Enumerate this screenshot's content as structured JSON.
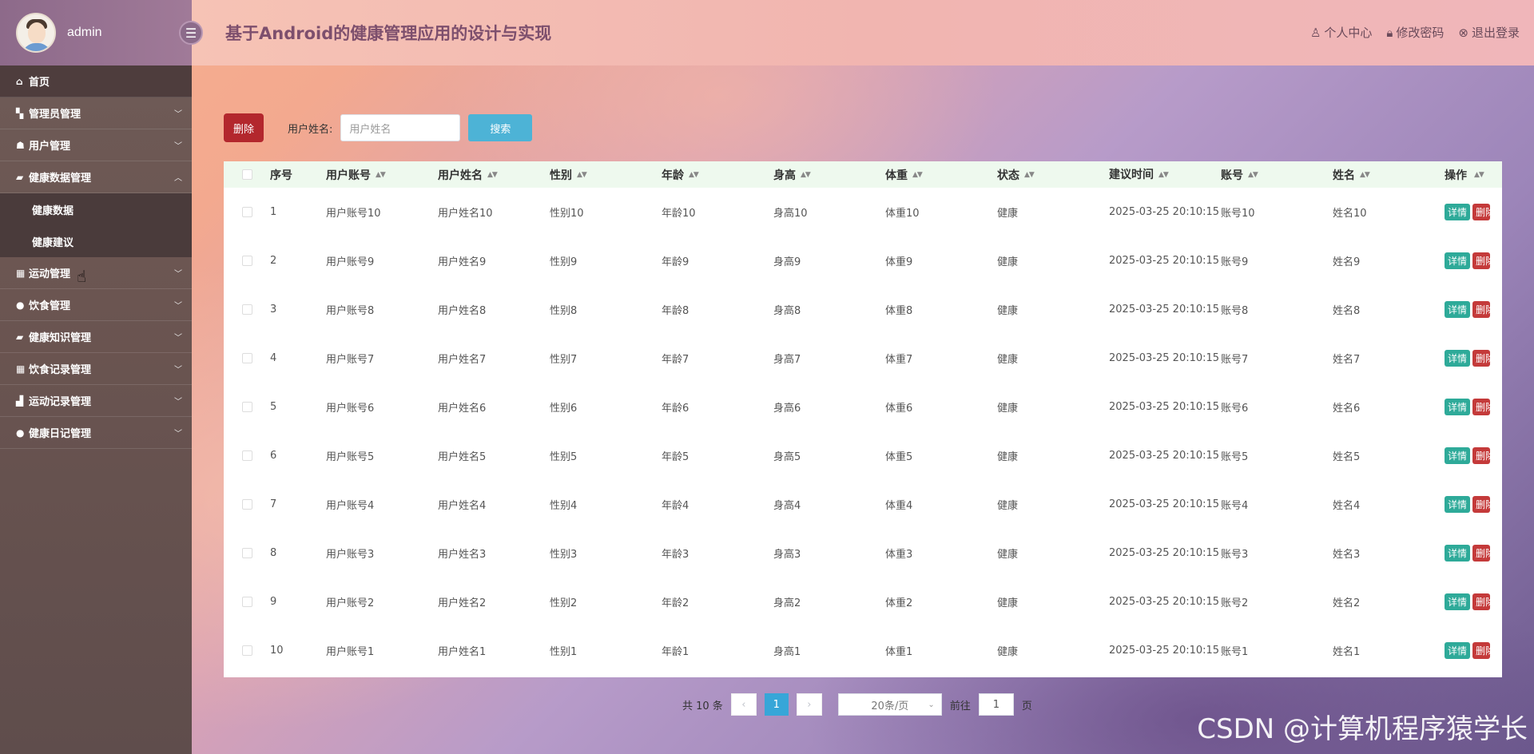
{
  "sidebar": {
    "username": "admin",
    "menu": [
      {
        "icon": "⌂",
        "label": "首页"
      },
      {
        "icon": "▚",
        "label": "管理员管理"
      },
      {
        "icon": "☗",
        "label": "用户管理"
      },
      {
        "icon": "▰",
        "label": "健康数据管理"
      },
      {
        "icon": "▦",
        "label": "运动管理"
      },
      {
        "icon": "●",
        "label": "饮食管理"
      },
      {
        "icon": "▰",
        "label": "健康知识管理"
      },
      {
        "icon": "▦",
        "label": "饮食记录管理"
      },
      {
        "icon": "▟",
        "label": "运动记录管理"
      },
      {
        "icon": "●",
        "label": "健康日记管理"
      }
    ],
    "submenu": [
      "健康数据",
      "健康建议"
    ]
  },
  "header": {
    "title": "基于Android的健康管理应用的设计与实现",
    "links": [
      "个人中心",
      "修改密码",
      "退出登录"
    ]
  },
  "toolbar": {
    "delete_label": "删除",
    "search_label": "用户姓名:",
    "search_placeholder": "用户姓名",
    "search_button": "搜索"
  },
  "table": {
    "columns": [
      "序号",
      "用户账号",
      "用户姓名",
      "性别",
      "年龄",
      "身高",
      "体重",
      "状态",
      "建议时间",
      "账号",
      "姓名",
      "操作"
    ],
    "rows": [
      [
        "1",
        "用户账号10",
        "用户姓名10",
        "性别10",
        "年龄10",
        "身高10",
        "体重10",
        "健康",
        "2025-03-25 20:10:15",
        "账号10",
        "姓名10"
      ],
      [
        "2",
        "用户账号9",
        "用户姓名9",
        "性别9",
        "年龄9",
        "身高9",
        "体重9",
        "健康",
        "2025-03-25 20:10:15",
        "账号9",
        "姓名9"
      ],
      [
        "3",
        "用户账号8",
        "用户姓名8",
        "性别8",
        "年龄8",
        "身高8",
        "体重8",
        "健康",
        "2025-03-25 20:10:15",
        "账号8",
        "姓名8"
      ],
      [
        "4",
        "用户账号7",
        "用户姓名7",
        "性别7",
        "年龄7",
        "身高7",
        "体重7",
        "健康",
        "2025-03-25 20:10:15",
        "账号7",
        "姓名7"
      ],
      [
        "5",
        "用户账号6",
        "用户姓名6",
        "性别6",
        "年龄6",
        "身高6",
        "体重6",
        "健康",
        "2025-03-25 20:10:15",
        "账号6",
        "姓名6"
      ],
      [
        "6",
        "用户账号5",
        "用户姓名5",
        "性别5",
        "年龄5",
        "身高5",
        "体重5",
        "健康",
        "2025-03-25 20:10:15",
        "账号5",
        "姓名5"
      ],
      [
        "7",
        "用户账号4",
        "用户姓名4",
        "性别4",
        "年龄4",
        "身高4",
        "体重4",
        "健康",
        "2025-03-25 20:10:15",
        "账号4",
        "姓名4"
      ],
      [
        "8",
        "用户账号3",
        "用户姓名3",
        "性别3",
        "年龄3",
        "身高3",
        "体重3",
        "健康",
        "2025-03-25 20:10:15",
        "账号3",
        "姓名3"
      ],
      [
        "9",
        "用户账号2",
        "用户姓名2",
        "性别2",
        "年龄2",
        "身高2",
        "体重2",
        "健康",
        "2025-03-25 20:10:15",
        "账号2",
        "姓名2"
      ],
      [
        "10",
        "用户账号1",
        "用户姓名1",
        "性别1",
        "年龄1",
        "身高1",
        "体重1",
        "健康",
        "2025-03-25 20:10:15",
        "账号1",
        "姓名1"
      ]
    ],
    "action_detail": "详情",
    "action_delete": "删除"
  },
  "pagination": {
    "total": "共 10 条",
    "current_page": "1",
    "page_size": "20条/页",
    "goto_label": "前往",
    "goto_value": "1",
    "page_unit": "页"
  },
  "watermark": "CSDN @计算机程序猿学长"
}
